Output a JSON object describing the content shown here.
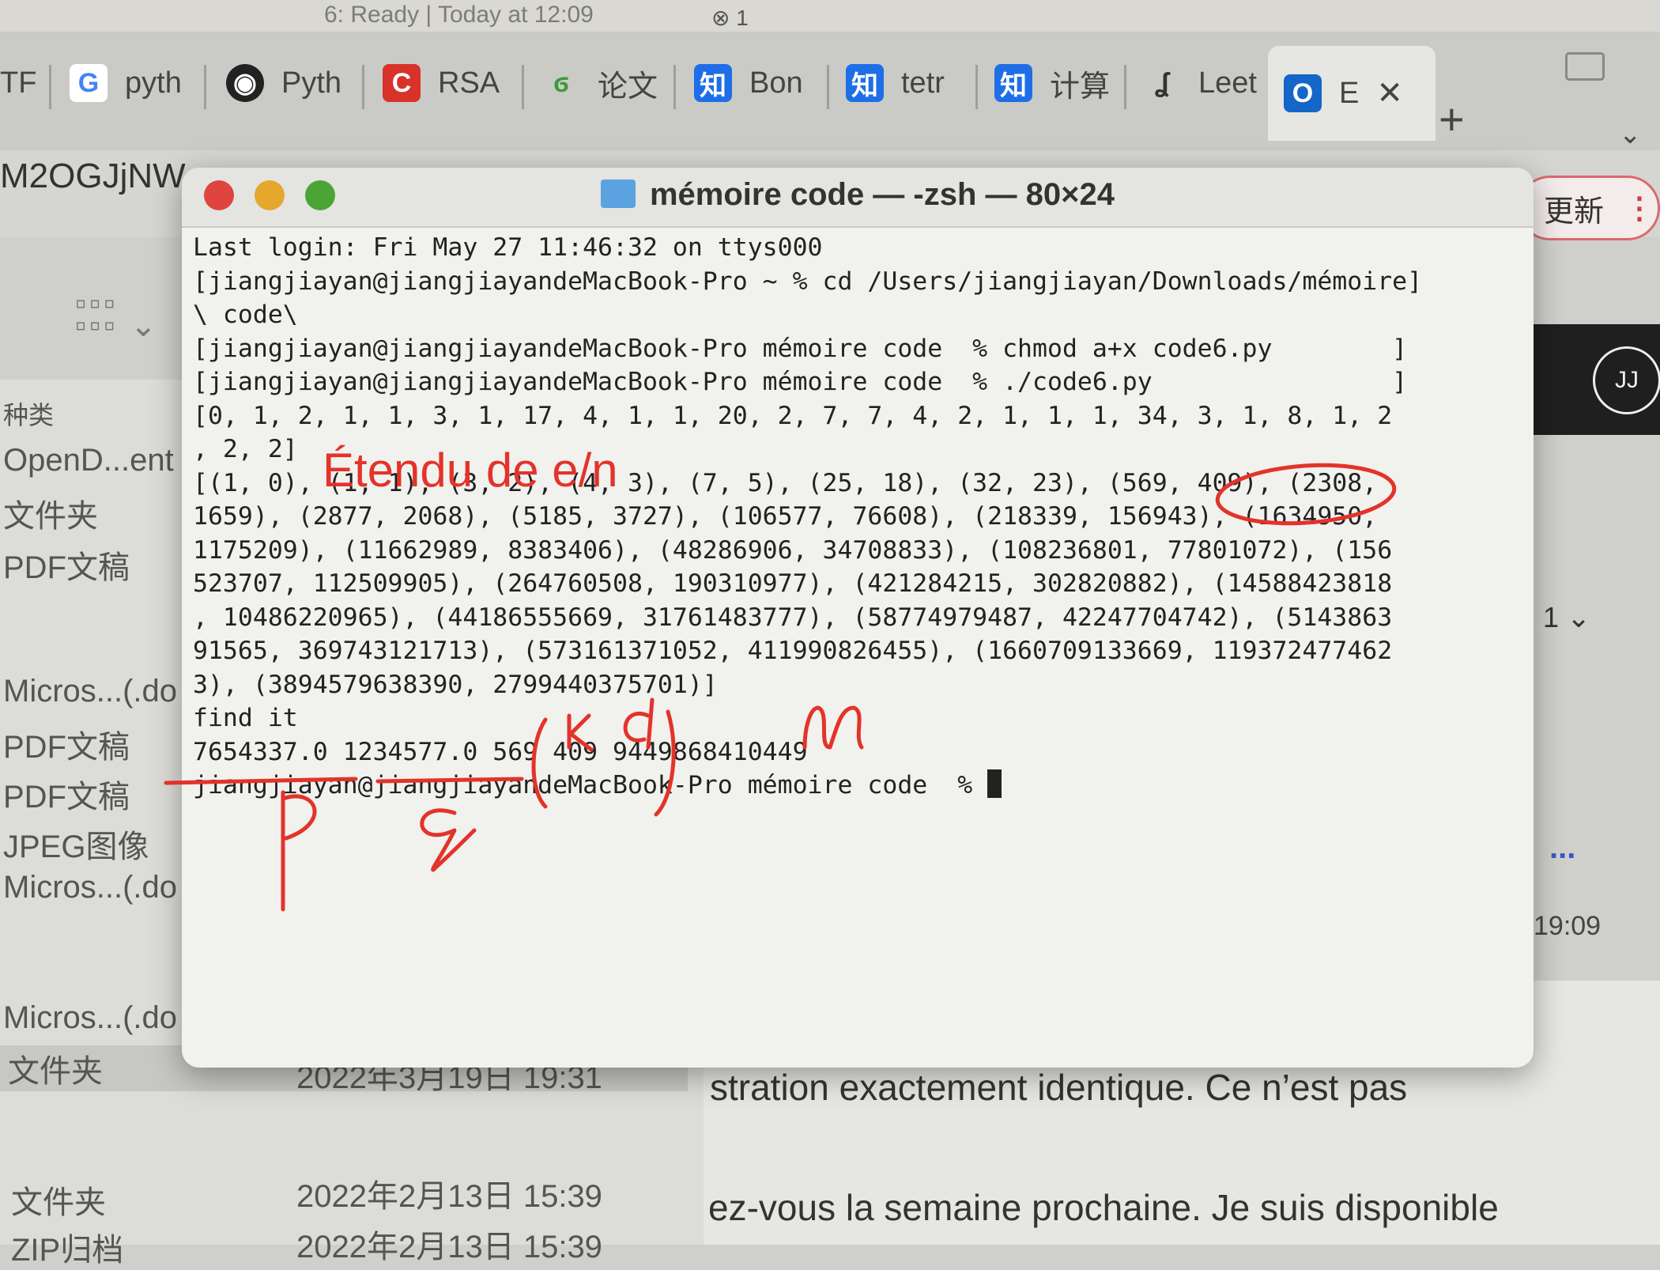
{
  "status": {
    "text": "6: Ready | Today at 12:09",
    "issue_count": "1"
  },
  "tabs": [
    {
      "label": "TF",
      "icon": "tab-icon"
    },
    {
      "label": "pyth",
      "icon": "google-icon"
    },
    {
      "label": "Pyth",
      "icon": "globe-icon"
    },
    {
      "label": "RSA",
      "icon": "c-logo-icon"
    },
    {
      "label": "论文",
      "icon": "leaf-icon"
    },
    {
      "label": "Bon",
      "icon": "zhihu-icon"
    },
    {
      "label": "tetr",
      "icon": "zhihu-icon"
    },
    {
      "label": "计算",
      "icon": "zhihu-icon"
    },
    {
      "label": "Leet",
      "icon": "leetcode-icon"
    },
    {
      "label": "E",
      "icon": "outlook-icon"
    }
  ],
  "tab_icon_glyphs": {
    "google": "G",
    "c": "C",
    "zhihu": "知"
  },
  "url_fragment": "M2OGJjNW",
  "update_button": "更新",
  "finder": {
    "kind_header": "种类",
    "rows": [
      {
        "kind": "OpenD...ent",
        "date": ""
      },
      {
        "kind": "文件夹",
        "date": ""
      },
      {
        "kind": "PDF文稿",
        "date": ""
      },
      {
        "kind": "Micros...(.do",
        "date": ""
      },
      {
        "kind": "PDF文稿",
        "date": ""
      },
      {
        "kind": "PDF文稿",
        "date": ""
      },
      {
        "kind": "JPEG图像",
        "date": ""
      },
      {
        "kind": "Micros...(.do",
        "date": ""
      },
      {
        "kind": "Micros...(.do",
        "date": ""
      },
      {
        "kind": "文件夹",
        "date": "2022年3月19日 19:31"
      },
      {
        "kind": "文件夹",
        "date": "2022年2月13日 15:39"
      },
      {
        "kind": "ZIP归档",
        "date": "2022年2月13日 15:39"
      }
    ]
  },
  "right": {
    "avatar": "JJ",
    "count": "1",
    "more": "...",
    "time": "19:09"
  },
  "doc": {
    "line1": "stration exactement identique. Ce n’est pas",
    "line2": "ez-vous la semaine prochaine. Je suis disponible"
  },
  "terminal": {
    "title": "mémoire code — -zsh — 80×24",
    "lines": [
      "Last login: Fri May 27 11:46:32 on ttys000",
      "[jiangjiayan@jiangjiayandeMacBook-Pro ~ % cd /Users/jiangjiayan/Downloads/mémoire]",
      "\\ code\\",
      "[jiangjiayan@jiangjiayandeMacBook-Pro mémoire code  % chmod a+x code6.py        ]",
      "[jiangjiayan@jiangjiayandeMacBook-Pro mémoire code  % ./code6.py                ]",
      "[0, 1, 2, 1, 1, 3, 1, 17, 4, 1, 1, 20, 2, 7, 7, 4, 2, 1, 1, 1, 34, 3, 1, 8, 1, 2",
      ", 2, 2]",
      "[(1, 0), (1, 1), (3, 2), (4, 3), (7, 5), (25, 18), (32, 23), (569, 409), (2308,",
      "1659), (2877, 2068), (5185, 3727), (106577, 76608), (218339, 156943), (1634950,",
      "1175209), (11662989, 8383406), (48286906, 34708833), (108236801, 77801072), (156",
      "523707, 112509905), (264760508, 190310977), (421284215, 302820882), (14588423818",
      ", 10486220965), (44186555669, 31761483777), (58774979487, 42247704742), (5143863",
      "91565, 369743121713), (573161371052, 411990826455), (1660709133669, 119372477462",
      "3), (3894579638390, 2799440375701)]",
      "find it",
      "7654337.0 1234577.0 569 409 9449868410449",
      "jiangjiayan@jiangjiayandeMacBook-Pro mémoire code  % "
    ]
  },
  "annotations": {
    "title": "Étendu de e/n",
    "p": "p",
    "q": "q",
    "k": "k",
    "d": "d",
    "n": "n",
    "ink_color": "#e3332a"
  }
}
